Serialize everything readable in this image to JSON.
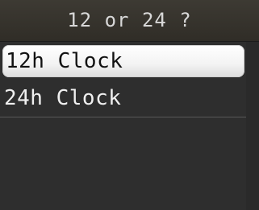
{
  "title": "12 or 24 ?",
  "options": [
    {
      "label": "12h Clock",
      "selected": true
    },
    {
      "label": "24h Clock",
      "selected": false
    }
  ]
}
